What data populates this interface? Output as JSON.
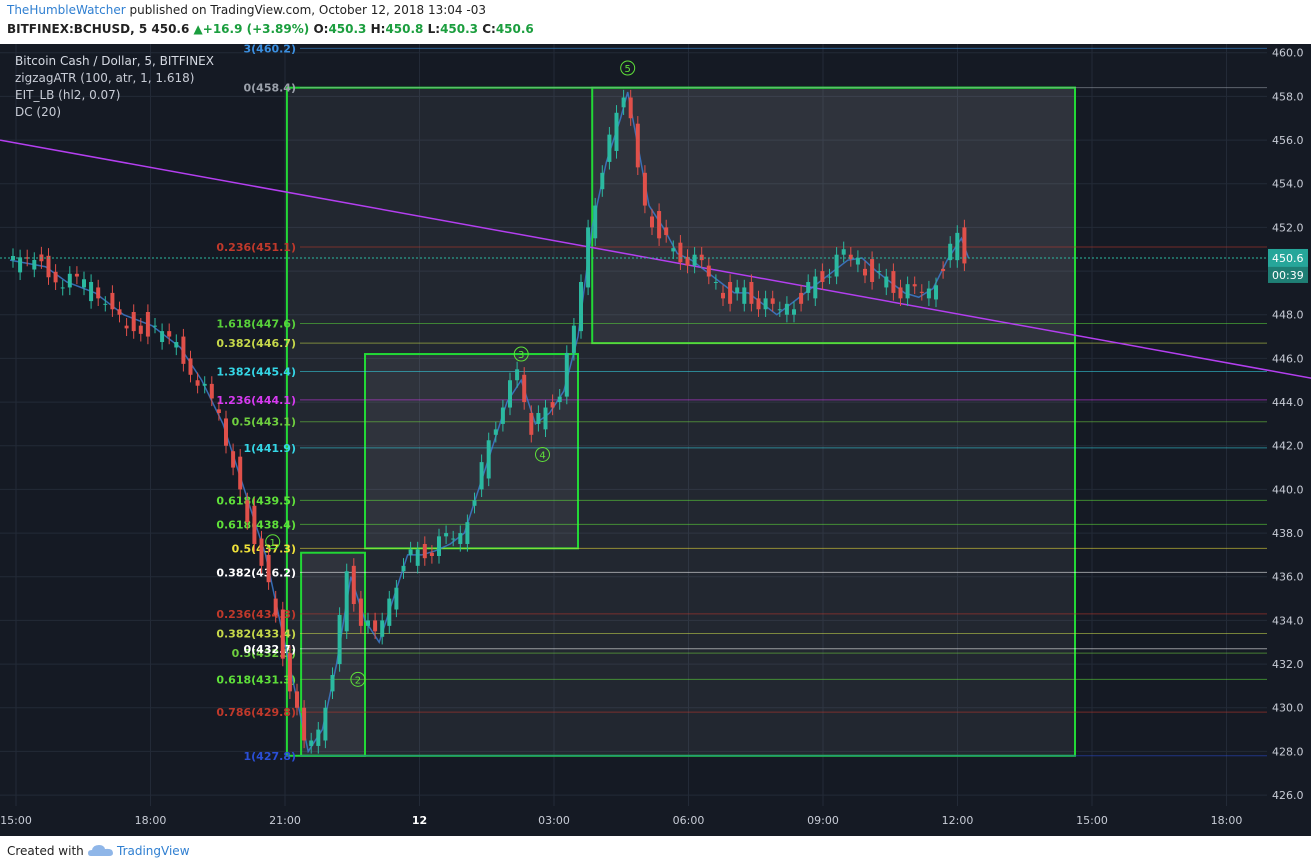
{
  "header": {
    "author": "TheHumbleWatcher",
    "published_text": " published on TradingView.com, October 12, 2018 13:04 -03",
    "symbol": "BITFINEX:BCHUSD, 5",
    "last": "450.6",
    "change": "+16.9 (+3.89%)",
    "o_label": "O:",
    "o": "450.3",
    "h_label": "H:",
    "h": "450.8",
    "l_label": "L:",
    "l": "450.3",
    "c_label": "C:",
    "c": "450.6"
  },
  "legend": {
    "title": "Bitcoin Cash / Dollar, 5, BITFINEX",
    "ind1": "zigzagATR (100, atr, 1, 1.618)",
    "ind2": "EIT_LB (hl2, 0.07)",
    "ind3": "DC (20)"
  },
  "footer": {
    "created_with": "Created with",
    "brand": "TradingView"
  },
  "chart_data": {
    "type": "candlestick",
    "y_ticks": [
      426.0,
      428.0,
      430.0,
      432.0,
      434.0,
      436.0,
      438.0,
      440.0,
      442.0,
      444.0,
      446.0,
      448.0,
      450.0,
      452.0,
      454.0,
      456.0,
      458.0,
      460.0
    ],
    "ylim": [
      425.5,
      460.4
    ],
    "x_ticks": [
      "15:00",
      "18:00",
      "21:00",
      "12",
      "03:00",
      "06:00",
      "09:00",
      "12:00",
      "15:00",
      "18:00"
    ],
    "price_label": "450.6",
    "countdown_label": "00:39",
    "path_points": [
      [
        0,
        450.5
      ],
      [
        5,
        450.2
      ],
      [
        8,
        449.5
      ],
      [
        12,
        449.0
      ],
      [
        16,
        448.0
      ],
      [
        20,
        447.5
      ],
      [
        24,
        446.5
      ],
      [
        27,
        445.0
      ],
      [
        30,
        443.0
      ],
      [
        33,
        440.0
      ],
      [
        36,
        437.0
      ],
      [
        38,
        434.0
      ],
      [
        40,
        431.0
      ],
      [
        42,
        428.0
      ],
      [
        44,
        429.0
      ],
      [
        46,
        432.0
      ],
      [
        48,
        436.0
      ],
      [
        50,
        434.0
      ],
      [
        52,
        433.0
      ],
      [
        54,
        435.0
      ],
      [
        56,
        437.0
      ],
      [
        58,
        437.0
      ],
      [
        60,
        437.2
      ],
      [
        62,
        437.5
      ],
      [
        64,
        438.0
      ],
      [
        66,
        440.0
      ],
      [
        68,
        442.0
      ],
      [
        70,
        444.0
      ],
      [
        72,
        445.0
      ],
      [
        73,
        444.0
      ],
      [
        74,
        443.0
      ],
      [
        76,
        443.5
      ],
      [
        78,
        444.5
      ],
      [
        80,
        447.0
      ],
      [
        82,
        452.0
      ],
      [
        84,
        455.0
      ],
      [
        86,
        457.0
      ],
      [
        87,
        458.2
      ],
      [
        88,
        456.5
      ],
      [
        90,
        453.0
      ],
      [
        92,
        452.0
      ],
      [
        94,
        450.8
      ],
      [
        96,
        450.5
      ],
      [
        98,
        450.0
      ],
      [
        100,
        449.5
      ],
      [
        102,
        449.0
      ],
      [
        104,
        449.0
      ],
      [
        106,
        448.5
      ],
      [
        108,
        448.0
      ],
      [
        110,
        448.5
      ],
      [
        112,
        449.0
      ],
      [
        114,
        449.5
      ],
      [
        116,
        450.0
      ],
      [
        118,
        450.5
      ],
      [
        120,
        450.6
      ],
      [
        122,
        450.0
      ],
      [
        124,
        449.5
      ],
      [
        126,
        449.0
      ],
      [
        128,
        448.8
      ],
      [
        130,
        449.2
      ],
      [
        132,
        450.5
      ],
      [
        134,
        451.5
      ],
      [
        135,
        450.6
      ]
    ],
    "fib_levels": [
      {
        "label": "3(460.2)",
        "value": 460.2,
        "color": "#3b8fe0"
      },
      {
        "label": "0(458.4)",
        "value": 458.4,
        "color": "#9aa0aa"
      },
      {
        "label": "0.236(451.1)",
        "value": 451.1,
        "color": "#c0392b"
      },
      {
        "label": "1.618(447.6)",
        "value": 447.6,
        "color": "#58d13a"
      },
      {
        "label": "0.382(446.7)",
        "value": 446.7,
        "color": "#c6d84a"
      },
      {
        "label": "1.382(445.4)",
        "value": 445.4,
        "color": "#35d6e6"
      },
      {
        "label": "1.236(444.1)",
        "value": 444.1,
        "color": "#d63af0"
      },
      {
        "label": "0.5(443.1)",
        "value": 443.1,
        "color": "#6fcf3f"
      },
      {
        "label": "1(441.9)",
        "value": 441.9,
        "color": "#35d6e6"
      },
      {
        "label": "0.618(439.5)",
        "value": 439.5,
        "color": "#5fe03a"
      },
      {
        "label": "0.618(438.4)",
        "value": 438.4,
        "color": "#5fe03a"
      },
      {
        "label": "0.5(437.3)",
        "value": 437.3,
        "color": "#f0e23a"
      },
      {
        "label": "0.382(436.2)",
        "value": 436.2,
        "color": "#ffffff"
      },
      {
        "label": "0.236(434.3)",
        "value": 434.3,
        "color": "#c0392b"
      },
      {
        "label": "0.382(433.4)",
        "value": 433.4,
        "color": "#c6d84a"
      },
      {
        "label": "0.5(432.5)",
        "value": 432.5,
        "color": "#6fcf3f"
      },
      {
        "label": "0(432.7)",
        "value": 432.7,
        "color": "#ffffff"
      },
      {
        "label": "0.618(431.3)",
        "value": 431.3,
        "color": "#5fe03a"
      },
      {
        "label": "0.786(429.8)",
        "value": 429.8,
        "color": "#c0392b"
      },
      {
        "label": "1(427.8)",
        "value": 427.8,
        "color": "#2a4fd6"
      }
    ],
    "wave_labels": [
      {
        "label": "1",
        "x": 37,
        "y": 437.6
      },
      {
        "label": "2",
        "x": 49,
        "y": 431.3
      },
      {
        "label": "3",
        "x": 72,
        "y": 446.2
      },
      {
        "label": "4",
        "x": 75,
        "y": 441.6
      },
      {
        "label": "5",
        "x": 87,
        "y": 459.3
      }
    ],
    "boxes": [
      {
        "x0": 39,
        "x1": 150,
        "y0": 427.8,
        "y1": 458.4
      },
      {
        "x0": 82,
        "x1": 150,
        "y0": 446.7,
        "y1": 458.4
      },
      {
        "x0": 50,
        "x1": 80,
        "y0": 437.3,
        "y1": 446.2
      },
      {
        "x0": 41,
        "x1": 50,
        "y0": 427.8,
        "y1": 437.1
      }
    ],
    "trendline": {
      "x0": 0,
      "y0": 456.0,
      "x1": 190,
      "y1": 444.7
    }
  }
}
